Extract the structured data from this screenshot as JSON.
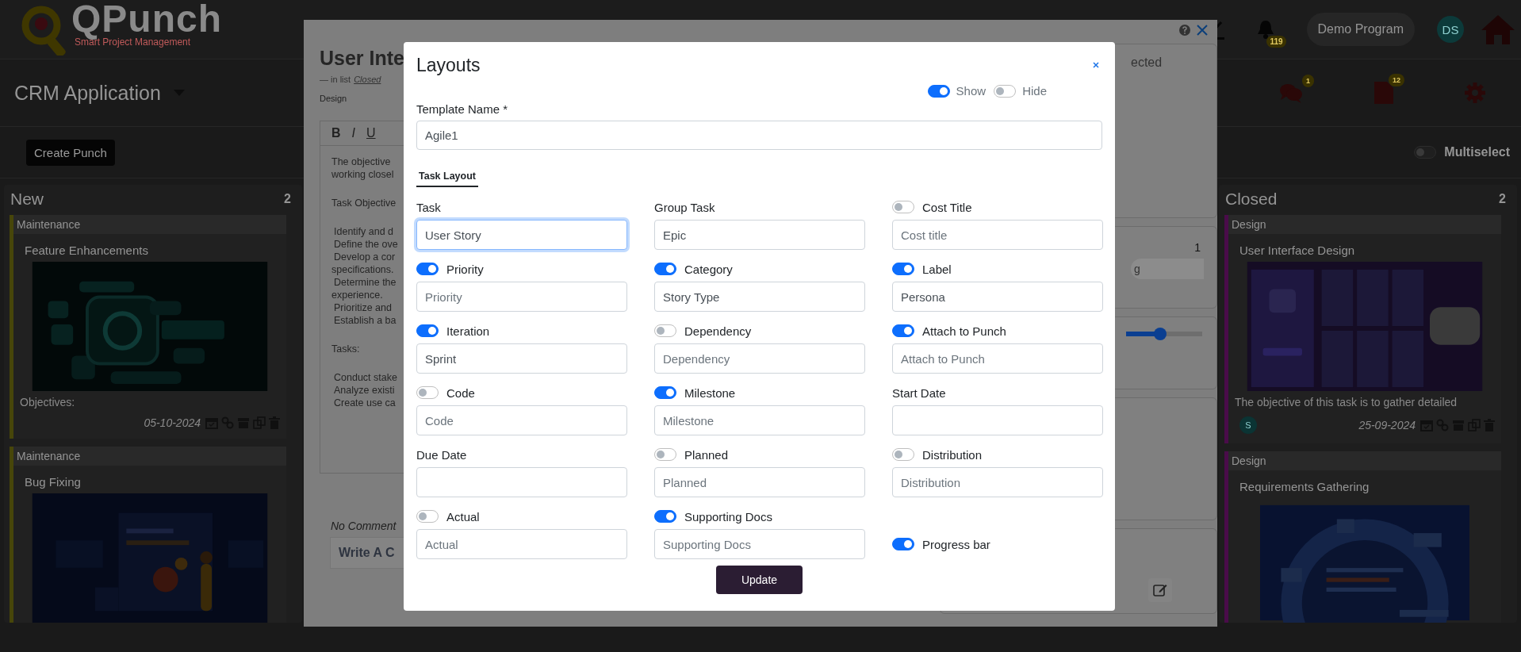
{
  "header": {
    "logo": {
      "name": "QPunch",
      "tagline": "Smart Project Management"
    },
    "notification_count": "119",
    "program": "Demo Program",
    "avatar": "DS"
  },
  "project": {
    "title": "CRM Application",
    "chat_count": "1",
    "document_count": "12"
  },
  "toolbar": {
    "create_button": "Create Punch",
    "multiselect": {
      "label": "Multiselect",
      "on": false
    }
  },
  "board": {
    "columns": [
      {
        "title": "New",
        "count": "2",
        "cards": [
          {
            "category": "Maintenance",
            "color": "#47460a",
            "title": "Feature Enhancements",
            "description": "Objectives:",
            "date": "05-10-2024"
          },
          {
            "category": "Maintenance",
            "color": "#47460a",
            "title": "Bug Fixing"
          }
        ]
      },
      {
        "title": "Closed",
        "count": "2",
        "cards": [
          {
            "category": "Design",
            "color": "#4a0c4a",
            "title": "User Interface Design",
            "description": "The objective of this task is to gather detailed",
            "avatar": "S",
            "date": "25-09-2024"
          },
          {
            "category": "Design",
            "color": "#4a0c4a",
            "title": "Requirements Gathering"
          }
        ]
      }
    ]
  },
  "task_modal": {
    "title": "User Inte",
    "list_prefix": "— in list",
    "list_name": "Closed",
    "tag": "Design",
    "format_buttons": [
      "B",
      "I",
      "U"
    ],
    "paragraphs": [
      {
        "lines": [
          {
            "kind": "text",
            "text": "The objective"
          },
          {
            "kind": "text",
            "text": "working closel"
          }
        ]
      },
      {
        "lines": [
          {
            "kind": "text",
            "text": "Task Objective"
          }
        ]
      },
      {
        "lines": [
          {
            "kind": "item",
            "text": "Identify and d"
          },
          {
            "kind": "item",
            "text": "Define the ove"
          },
          {
            "kind": "item",
            "text": "Develop a cor"
          },
          {
            "kind": "text",
            "text": "specifications."
          },
          {
            "kind": "item",
            "text": "Determine the"
          },
          {
            "kind": "text",
            "text": "experience."
          },
          {
            "kind": "item",
            "text": "Prioritize and"
          },
          {
            "kind": "item",
            "text": "Establish a ba"
          }
        ]
      },
      {
        "lines": [
          {
            "kind": "text",
            "text": "Tasks:"
          }
        ]
      },
      {
        "lines": [
          {
            "kind": "item",
            "text": "Conduct stake"
          },
          {
            "kind": "item",
            "text": "Analyze existi"
          },
          {
            "kind": "item",
            "text": "Create use ca"
          }
        ]
      }
    ],
    "comments_status": "No Comment",
    "comment_placeholder": "Write A C",
    "sidebar": {
      "status_text": "ected",
      "count": "1",
      "chip": "g",
      "slider": {
        "level": 0.45
      }
    }
  },
  "layouts_modal": {
    "title": "Layouts",
    "visibility": [
      {
        "label": "Show",
        "on": true
      },
      {
        "label": "Hide",
        "on": false
      }
    ],
    "template_name": {
      "label": "Template Name *",
      "value": "Agile1"
    },
    "tabs": [
      {
        "label": "Task Layout",
        "selected": true
      }
    ],
    "fields": [
      {
        "kind": "input",
        "label": "Task",
        "value": "User Story",
        "focused": true
      },
      {
        "kind": "input",
        "label": "Group Task",
        "value": "Epic",
        "focused": false
      },
      {
        "kind": "toggle_input",
        "label": "Cost Title",
        "on": false,
        "placeholder": "Cost title",
        "focused": false
      },
      {
        "kind": "toggle_input",
        "label": "Priority",
        "on": true,
        "placeholder": "Priority",
        "focused": false
      },
      {
        "kind": "toggle_input",
        "label": "Category",
        "on": true,
        "value": "Story Type",
        "focused": false
      },
      {
        "kind": "toggle_input",
        "label": "Label",
        "on": true,
        "value": "Persona",
        "focused": false
      },
      {
        "kind": "toggle_input",
        "label": "Iteration",
        "on": true,
        "value": "Sprint",
        "focused": false
      },
      {
        "kind": "toggle_input",
        "label": "Dependency",
        "on": false,
        "placeholder": "Dependency",
        "focused": false
      },
      {
        "kind": "toggle_input",
        "label": "Attach to Punch",
        "on": true,
        "placeholder": "Attach to Punch",
        "focused": false
      },
      {
        "kind": "toggle_input",
        "label": "Code",
        "on": false,
        "placeholder": "Code",
        "focused": false
      },
      {
        "kind": "toggle_input",
        "label": "Milestone",
        "on": true,
        "placeholder": "Milestone",
        "focused": false
      },
      {
        "kind": "input",
        "label": "Start Date",
        "focused": false
      },
      {
        "kind": "input",
        "label": "Due Date",
        "focused": false
      },
      {
        "kind": "toggle_input",
        "label": "Planned",
        "on": false,
        "placeholder": "Planned",
        "focused": false
      },
      {
        "kind": "toggle_input",
        "label": "Distribution",
        "on": false,
        "placeholder": "Distribution",
        "focused": false
      },
      {
        "kind": "toggle_input",
        "label": "Actual",
        "on": false,
        "placeholder": "Actual",
        "focused": false
      },
      {
        "kind": "toggle_input",
        "label": "Supporting Docs",
        "on": true,
        "placeholder": "Supporting Docs",
        "focused": false
      },
      {
        "kind": "toggle",
        "label": "Progress bar",
        "on": true
      }
    ],
    "update_button": "Update"
  }
}
